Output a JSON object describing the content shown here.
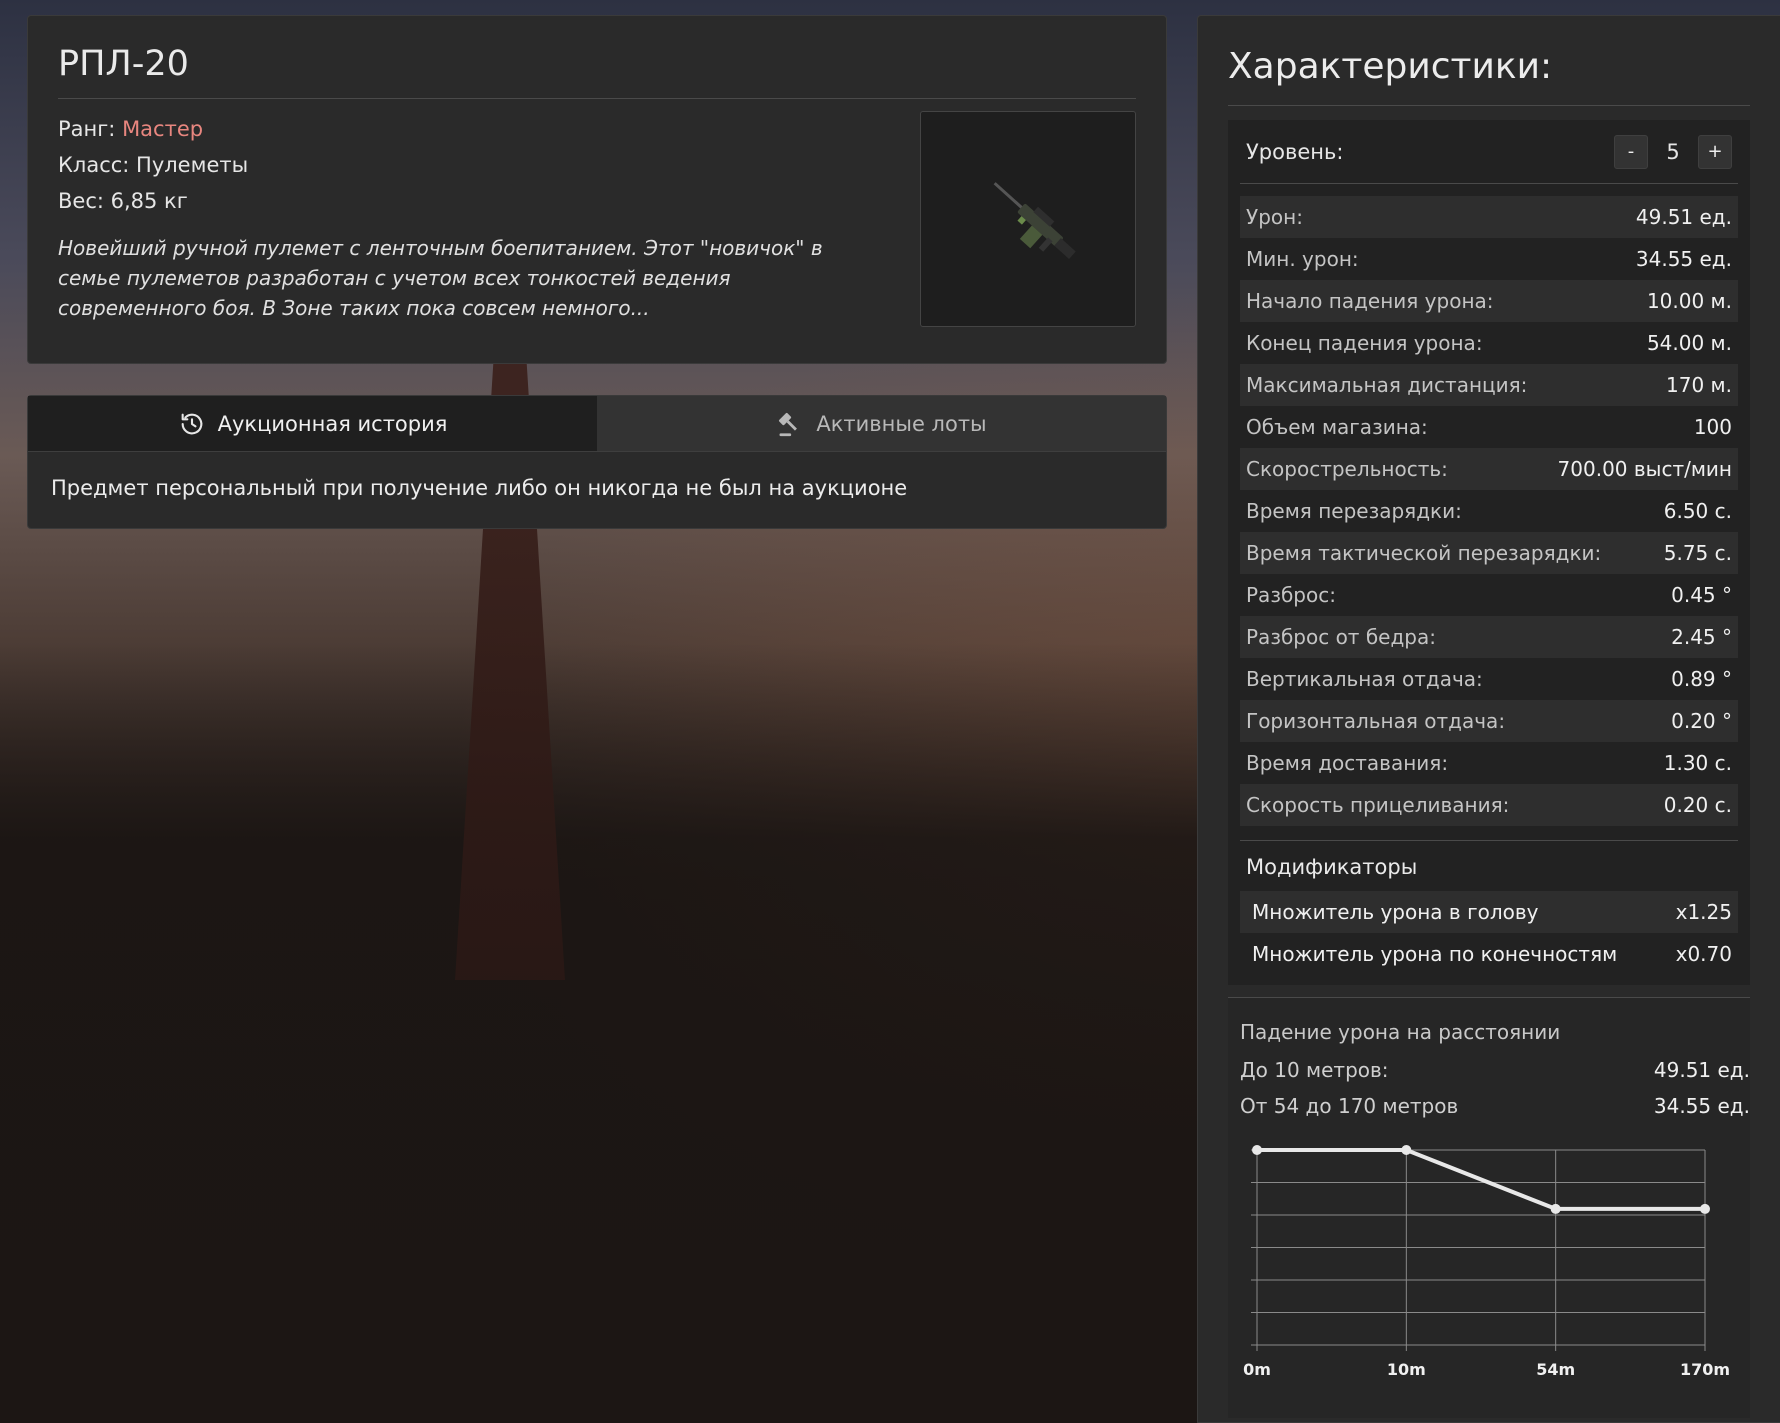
{
  "item": {
    "title": "РПЛ-20",
    "rank_label": "Ранг:",
    "rank_value": "Мастер",
    "class_line": "Класс: Пулеметы",
    "weight_line": "Вес: 6,85 кг",
    "description": "Новейший ручной пулемет с ленточным боепитанием. Этот \"новичок\" в семье пулеметов разработан с учетом всех тонкостей ведения современного боя. В Зоне таких пока совсем немного..."
  },
  "tabs": [
    {
      "label": "Аукционная история",
      "icon": "history-icon",
      "active": true
    },
    {
      "label": "Активные лоты",
      "icon": "gavel-icon",
      "active": false
    }
  ],
  "tab_content": "Предмет персональный при получение либо он никогда не был на аукционе",
  "stats": {
    "title": "Характеристики:",
    "level_label": "Уровень:",
    "level_minus": "-",
    "level_value": "5",
    "level_plus": "+",
    "rows": [
      {
        "label": "Урон:",
        "value": "49.51 ед."
      },
      {
        "label": "Мин. урон:",
        "value": "34.55 ед."
      },
      {
        "label": "Начало падения урона:",
        "value": "10.00 м."
      },
      {
        "label": "Конец падения урона:",
        "value": "54.00 м."
      },
      {
        "label": "Максимальная дистанция:",
        "value": "170 м."
      },
      {
        "label": "Объем магазина:",
        "value": "100"
      },
      {
        "label": "Скорострельность:",
        "value": "700.00 выст/мин"
      },
      {
        "label": "Время перезарядки:",
        "value": "6.50 с."
      },
      {
        "label": "Время тактической перезарядки:",
        "value": "5.75 с."
      },
      {
        "label": "Разброс:",
        "value": "0.45 °"
      },
      {
        "label": "Разброс от бедра:",
        "value": "2.45 °"
      },
      {
        "label": "Вертикальная отдача:",
        "value": "0.89 °"
      },
      {
        "label": "Горизонтальная отдача:",
        "value": "0.20 °"
      },
      {
        "label": "Время доставания:",
        "value": "1.30 с."
      },
      {
        "label": "Скорость прицеливания:",
        "value": "0.20 с."
      }
    ],
    "modifiers_title": "Модификаторы",
    "modifiers": [
      {
        "label": "Множитель урона в голову",
        "value": "x1.25"
      },
      {
        "label": "Множитель урона по конечностям",
        "value": "x0.70"
      }
    ]
  },
  "falloff": {
    "title": "Падение урона на расстоянии",
    "rows": [
      {
        "label": "До 10 метров:",
        "value": "49.51 ед."
      },
      {
        "label": "От 54 до 170 метров",
        "value": "34.55 ед."
      }
    ]
  },
  "chart_data": {
    "type": "line",
    "categories": [
      "0m",
      "10m",
      "54m",
      "170m"
    ],
    "values": [
      49.51,
      49.51,
      34.55,
      34.55
    ],
    "title": "",
    "xlabel": "",
    "ylabel": "",
    "grid": true,
    "line_color": "#e8e8e8"
  }
}
